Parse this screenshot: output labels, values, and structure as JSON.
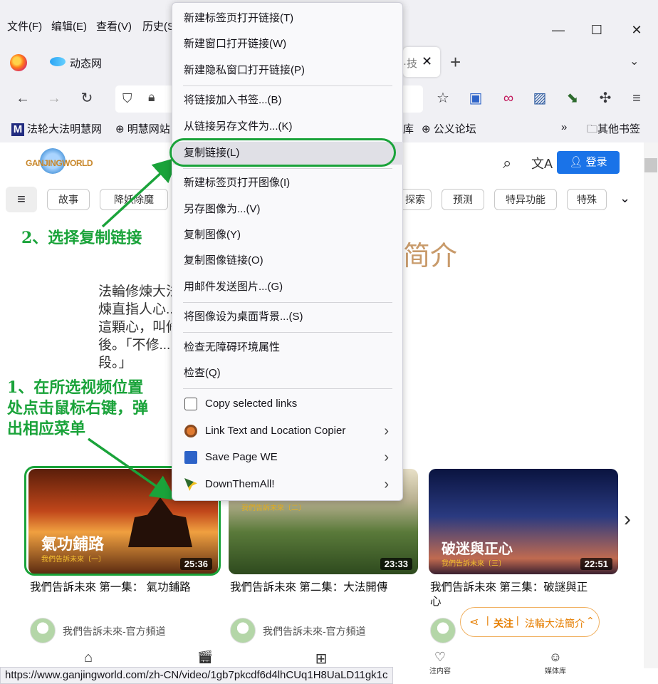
{
  "menubar": {
    "file": "文件(F)",
    "edit": "编辑(E)",
    "view": "查看(V)",
    "history": "历史(S"
  },
  "tabs": [
    {
      "label": "动态网"
    },
    {
      "label": "·技"
    }
  ],
  "bookmarks": [
    {
      "label": "法轮大法明慧网"
    },
    {
      "label": "明慧网站"
    },
    {
      "label": "库"
    },
    {
      "label": "公义论坛"
    },
    {
      "label": "其他书签"
    }
  ],
  "site": {
    "logo_text": "GANJINGWORLD",
    "login_label": "登录",
    "chips": [
      "故事",
      "降妖除魔",
      "探索",
      "预测",
      "特异功能",
      "特殊"
    ],
    "heading_fragment": "简介",
    "description": [
      "法輪修煉大法是......煉大法。法輪大法的修",
      "煉直指人心......忍」的標準修煉自己的",
      "這顆心，叫修......單易學。 修在先，煉在",
      "後。「不修......動作是圓滿的輔助手",
      "段。」"
    ],
    "videos": [
      {
        "title": "我們告訴未來 第一集： 氣功鋪路",
        "duration": "25:36",
        "overlay_title": "氣功鋪路",
        "overlay_sub": "我們告訴未來〔一〕",
        "channel": "我們告訴未來-官方頻道"
      },
      {
        "title": "我們告訴未來 第二集：大法開傳",
        "duration": "23:33",
        "overlay_title": "",
        "overlay_sub": "我們告訴未來〔二〕",
        "channel": "我們告訴未來-官方頻道"
      },
      {
        "title": "我們告訴未來 第三集：破謎與正心",
        "duration": "22:51",
        "overlay_title": "破迷與正心",
        "overlay_sub": "我們告訴未來〔三〕",
        "channel": ""
      }
    ],
    "follow_bar": {
      "follow": "关注",
      "channel": "法輪大法簡介"
    },
    "bottom_nav": [
      {
        "label": ""
      },
      {
        "label": ""
      },
      {
        "label": ""
      },
      {
        "label": "注内容"
      },
      {
        "label": "媒体库"
      }
    ]
  },
  "context_menu": {
    "items": [
      {
        "label": "新建标签页打开链接(T)"
      },
      {
        "label": "新建窗口打开链接(W)"
      },
      {
        "label": "新建隐私窗口打开链接(P)"
      },
      {
        "label": "将链接加入书签...(B)"
      },
      {
        "label": "从链接另存文件为...(K)"
      },
      {
        "label": "复制链接(L)"
      },
      {
        "label": "新建标签页打开图像(I)"
      },
      {
        "label": "另存图像为...(V)"
      },
      {
        "label": "复制图像(Y)"
      },
      {
        "label": "复制图像链接(O)"
      },
      {
        "label": "用邮件发送图片...(G)"
      },
      {
        "label": "将图像设为桌面背景...(S)"
      },
      {
        "label": "检查无障碍环境属性"
      },
      {
        "label": "检查(Q)"
      },
      {
        "label": "Copy selected links"
      },
      {
        "label": "Link Text and Location Copier"
      },
      {
        "label": "Save Page WE"
      },
      {
        "label": "DownThemAll!"
      }
    ]
  },
  "annotations": {
    "step2": "2、选择复制链接",
    "step1_lines": [
      "1、在所选视频位置",
      "处点击鼠标右键，弹",
      "出相应菜单"
    ]
  },
  "status_url": "https://www.ganjingworld.com/zh-CN/video/1gb7pkcdf6d4lhCUq1H8UaLD11gk1c",
  "colors": {
    "annotation_green": "#1aa33a",
    "login_blue": "#1a73e8",
    "follow_orange": "#e67e00"
  }
}
